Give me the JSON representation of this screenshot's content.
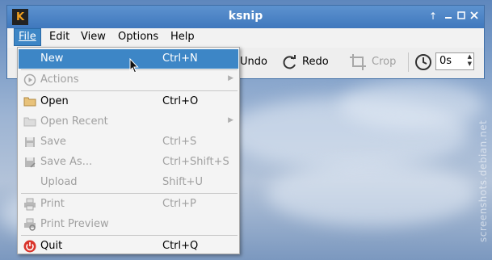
{
  "window": {
    "title": "ksnip",
    "controls": [
      "keep-above",
      "minimize",
      "maximize",
      "close"
    ]
  },
  "menubar": {
    "items": [
      {
        "label": "File",
        "accel": "F"
      },
      {
        "label": "Edit",
        "accel": "E"
      },
      {
        "label": "View",
        "accel": "V"
      },
      {
        "label": "Options",
        "accel": "O"
      },
      {
        "label": "Help",
        "accel": "H"
      }
    ],
    "open_menu": "File"
  },
  "toolbar": {
    "undo_label": "Undo",
    "redo_label": "Redo",
    "crop_label": "Crop",
    "delay_value": "0s"
  },
  "file_menu": {
    "items": [
      {
        "label": "New",
        "shortcut": "Ctrl+N",
        "enabled": true,
        "highlighted": true,
        "icon": "none"
      },
      {
        "label": "Actions",
        "shortcut": "",
        "enabled": false,
        "submenu": true,
        "icon": "play-circle-icon"
      },
      {
        "label": "Open",
        "shortcut": "Ctrl+O",
        "enabled": true,
        "icon": "folder-icon"
      },
      {
        "label": "Open Recent",
        "shortcut": "",
        "enabled": false,
        "submenu": true,
        "icon": "folder-icon"
      },
      {
        "label": "Save",
        "shortcut": "Ctrl+S",
        "enabled": false,
        "icon": "save-icon"
      },
      {
        "label": "Save As...",
        "shortcut": "Ctrl+Shift+S",
        "enabled": false,
        "icon": "save-as-icon"
      },
      {
        "label": "Upload",
        "shortcut": "Shift+U",
        "enabled": false,
        "icon": "none"
      },
      {
        "label": "Print",
        "shortcut": "Ctrl+P",
        "enabled": false,
        "icon": "printer-icon"
      },
      {
        "label": "Print Preview",
        "shortcut": "",
        "enabled": false,
        "icon": "print-preview-icon"
      },
      {
        "label": "Quit",
        "shortcut": "Ctrl+Q",
        "enabled": true,
        "icon": "power-icon"
      }
    ]
  },
  "watermark": "screenshots.debian.net",
  "colors": {
    "titlebar": "#3f78bd",
    "highlight": "#3d86c6",
    "quit_icon": "#d9342b",
    "disabled_text": "#a0a0a0"
  }
}
